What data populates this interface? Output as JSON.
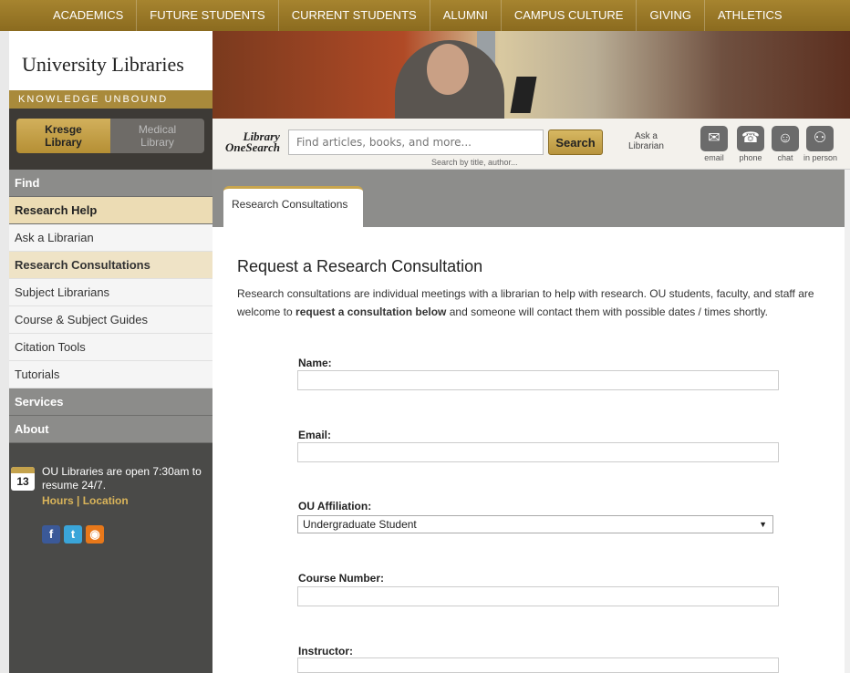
{
  "topnav": [
    "ACADEMICS",
    "FUTURE STUDENTS",
    "CURRENT STUDENTS",
    "ALUMNI",
    "CAMPUS CULTURE",
    "GIVING",
    "ATHLETICS"
  ],
  "brand": {
    "title": "University Libraries",
    "tagline": "KNOWLEDGE UNBOUND"
  },
  "libraries": {
    "kresge": "Kresge\nLibrary",
    "medical": "Medical\nLibrary"
  },
  "search": {
    "brand": "Library\nOneSearch",
    "placeholder": "Find articles, books, and more...",
    "button": "Search",
    "hint": "Search by title, author..."
  },
  "ask": {
    "label": "Ask a\nLibrarian",
    "options": [
      "email",
      "phone",
      "chat",
      "in person"
    ]
  },
  "sidebar": {
    "find": "Find",
    "research_help": "Research Help",
    "items": [
      "Ask a Librarian",
      "Research Consultations",
      "Subject Librarians",
      "Course & Subject Guides",
      "Citation Tools",
      "Tutorials"
    ],
    "services": "Services",
    "about": "About",
    "hours_date": "13",
    "hours_text": "OU Libraries are open 7:30am to\nresume 24/7.",
    "hours_link": "Hours",
    "location_link": "Location",
    "separator": " | "
  },
  "main": {
    "tab": "Research Consultations",
    "heading": "Request a Research Consultation",
    "intro_1": "Research consultations are individual meetings with a librarian to help with research. OU students, faculty, and staff are welcome to ",
    "intro_bold": "request a consultation below",
    "intro_2": " and someone will contact them with possible dates / times shortly.",
    "fields": {
      "name": "Name:",
      "email": "Email:",
      "affiliation": "OU Affiliation:",
      "affiliation_value": "Undergraduate Student",
      "course": "Course Number:",
      "instructor": "Instructor:"
    }
  }
}
